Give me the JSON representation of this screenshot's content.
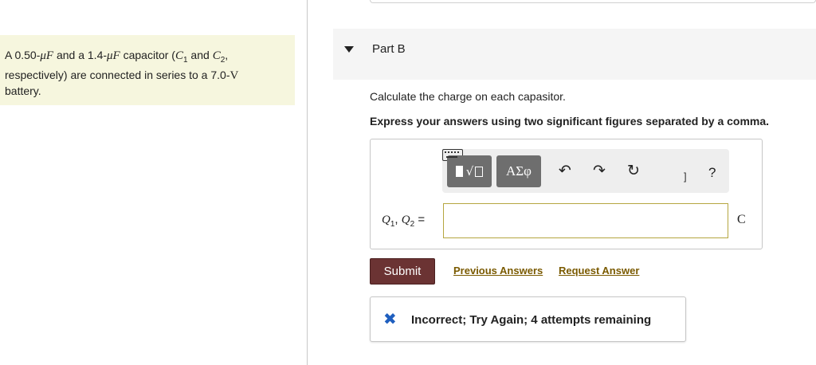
{
  "problem": {
    "text_1": "A 0.50-",
    "unit_1": "μF",
    "text_2": " and a 1.4-",
    "unit_2": "μF",
    "text_3": " capacitor (",
    "c1": "C",
    "c1_sub": "1",
    "text_4": " and ",
    "c2": "C",
    "c2_sub": "2",
    "text_5": ",",
    "text_6": "respectively) are connected in series to a 7.0-",
    "volt_unit": "V",
    "text_7": "battery."
  },
  "part": {
    "title": "Part B",
    "instruction": "Calculate the charge on each capasitor.",
    "express": "Express your answers using two significant figures separated by a comma."
  },
  "toolbar": {
    "templates_icon": "templates-icon",
    "greek_label": "ΑΣφ",
    "undo_glyph": "↶",
    "redo_glyph": "↷",
    "reset_glyph": "↻",
    "bracket_glyph": "]",
    "help_label": "?"
  },
  "answer": {
    "q1": "Q",
    "q1_sub": "1",
    "sep": ", ",
    "q2": "Q",
    "q2_sub": "2",
    "equals": " =",
    "input_value": "",
    "unit": "C"
  },
  "actions": {
    "submit_label": "Submit",
    "previous_answers": "Previous Answers",
    "request_answer": "Request Answer"
  },
  "feedback": {
    "icon_glyph": "✖",
    "message": "Incorrect; Try Again; 4 attempts remaining"
  },
  "colors": {
    "problem_bg": "#f6f6de",
    "submit_bg": "#6b3333",
    "link_color": "#7a5a00",
    "feedback_icon": "#1f5fbf",
    "input_border": "#b5a640"
  }
}
